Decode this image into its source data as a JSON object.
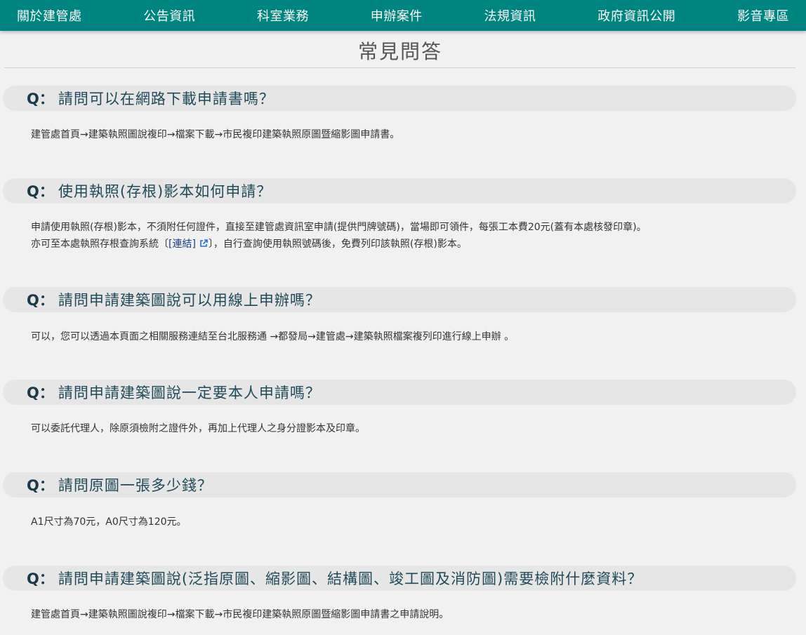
{
  "nav": {
    "items": [
      {
        "label": "關於建管處"
      },
      {
        "label": "公告資訊"
      },
      {
        "label": "科室業務"
      },
      {
        "label": "申辦案件"
      },
      {
        "label": "法規資訊"
      },
      {
        "label": "政府資訊公開"
      },
      {
        "label": "影音專區"
      }
    ]
  },
  "page": {
    "title": "常見問答"
  },
  "faq": {
    "q_prefix": "Q：",
    "items": [
      {
        "question": "請問可以在網路下載申請書嗎？",
        "answer": "建管處首頁→建築執照圖說複印→檔案下載→市民複印建築執照原圖暨縮影圖申請書。"
      },
      {
        "question": "使用執照(存根)影本如何申請？",
        "answer": "申請使用執照(存根)影本，不須附任何證件，直接至建管處資訊室申請(提供門牌號碼)，當場即可領件，每張工本費20元(蓋有本處核發印章)。",
        "answer2_before": "亦可至本處執照存根查詢系統〔",
        "answer2_link": "[連結]",
        "answer2_after": "〕，自行查詢使用執照號碼後，免費列印該執照(存根)影本。"
      },
      {
        "question": "請問申請建築圖說可以用線上申辦嗎？",
        "answer": "可以，您可以透過本頁面之相關服務連結至台北服務通 →都發局→建管處→建築執照檔案複列印進行線上申辦 。"
      },
      {
        "question": "請問申請建築圖說一定要本人申請嗎？",
        "answer": "可以委託代理人，除原須檢附之證件外，再加上代理人之身分證影本及印章。"
      },
      {
        "question": "請問原圖一張多少錢？",
        "answer": "A1尺寸為70元，A0尺寸為120元。"
      },
      {
        "question": "請問申請建築圖說(泛指原圖、縮影圖、結構圖、竣工圖及消防圖)需要檢附什麼資料？",
        "answer": "建管處首頁→建築執照圖說複印→檔案下載→市民複印建築執照原圖暨縮影圖申請書之申請說明。"
      }
    ]
  },
  "colors": {
    "nav_bg": "#00847f",
    "question_bg": "#e6e6e6",
    "link": "#1a3a8a"
  },
  "icons": {
    "external_link": "external-link-icon"
  }
}
